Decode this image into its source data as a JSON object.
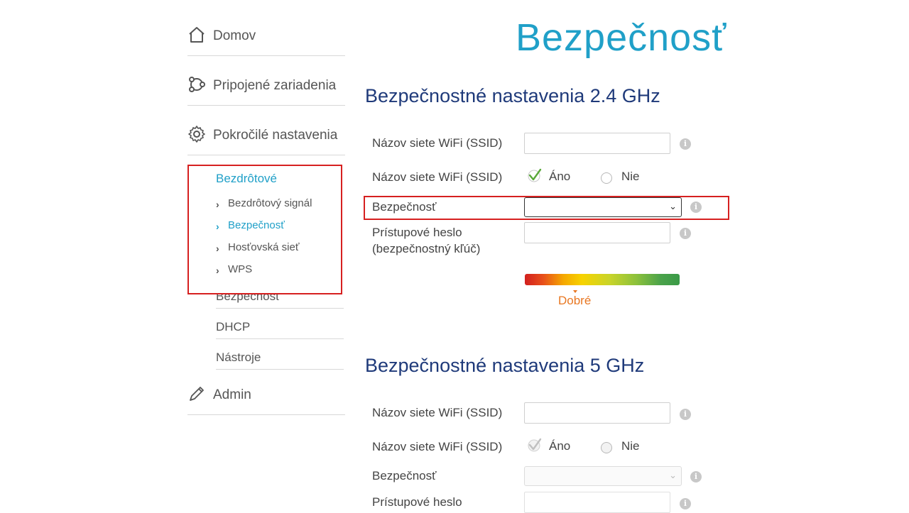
{
  "sidebar": {
    "home": {
      "label": "Domov",
      "icon": "home-icon"
    },
    "devices": {
      "label": "Pripojené zariadenia",
      "icon": "devices-icon"
    },
    "advanced": {
      "label": "Pokročilé nastavenia",
      "icon": "gear-icon"
    },
    "wireless": {
      "label": "Bezdrôtové",
      "items": [
        {
          "label": "Bezdrôtový signál",
          "active": false
        },
        {
          "label": "Bezpečnosť",
          "active": true
        },
        {
          "label": "Hosťovská sieť",
          "active": false
        },
        {
          "label": "WPS",
          "active": false
        }
      ]
    },
    "security": {
      "label": "Bezpečnosť"
    },
    "dhcp": {
      "label": "DHCP"
    },
    "tools": {
      "label": "Nástroje"
    },
    "admin": {
      "label": "Admin",
      "icon": "pencil-icon"
    }
  },
  "page": {
    "title": "Bezpečnosť"
  },
  "section24": {
    "title": "Bezpečnostné nastavenia 2.4 GHz",
    "ssid_label": "Názov siete WiFi (SSID)",
    "ssid_value": "",
    "broadcast_label": "Názov siete WiFi (SSID)",
    "yes_label": "Áno",
    "no_label": "Nie",
    "broadcast_selected": "Áno",
    "security_label": "Bezpečnosť",
    "security_value": "",
    "password_label_line1": "Prístupové heslo",
    "password_label_line2": "(bezpečnostný kľúč)",
    "password_value": "",
    "strength_label": "Dobré"
  },
  "section5": {
    "title": "Bezpečnostné nastavenia 5 GHz",
    "ssid_label": "Názov siete WiFi (SSID)",
    "ssid_value": "",
    "broadcast_label": "Názov siete WiFi (SSID)",
    "yes_label": "Áno",
    "no_label": "Nie",
    "broadcast_selected": "Áno",
    "security_label": "Bezpečnosť",
    "security_value": "",
    "password_label_line1": "Prístupové heslo",
    "password_value": ""
  },
  "colors": {
    "accent": "#20a0c8",
    "heading": "#1f3a7a",
    "highlight_box": "#d62020",
    "strength_good": "#e87722",
    "check": "#5aa83a"
  }
}
